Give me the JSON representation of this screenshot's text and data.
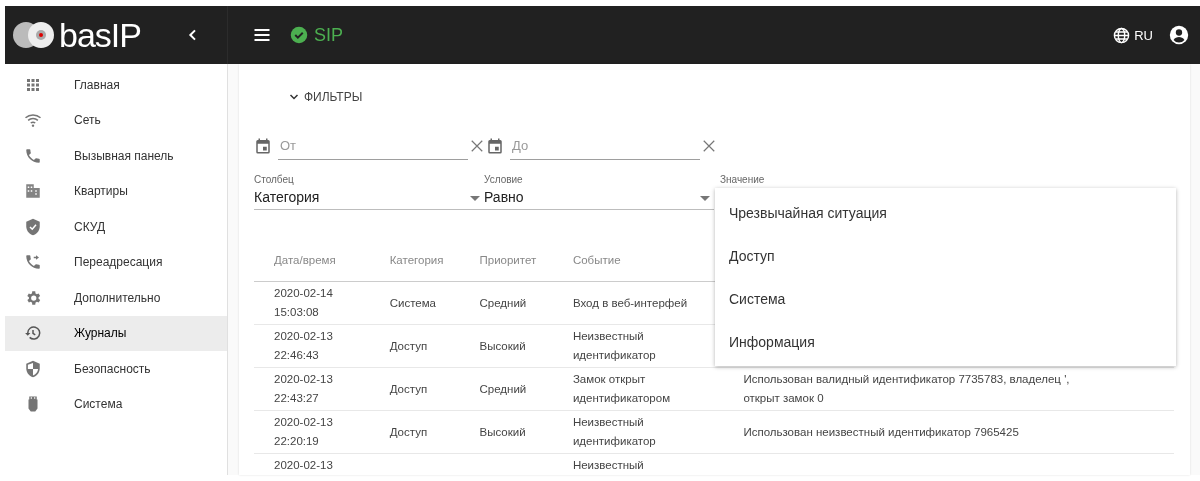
{
  "header": {
    "logo": "basIP",
    "status": {
      "label": "SIP",
      "ok": true
    },
    "language": "RU"
  },
  "sidebar": {
    "items": [
      {
        "label": "Главная",
        "selected": false
      },
      {
        "label": "Сеть",
        "selected": false
      },
      {
        "label": "Вызывная панель",
        "selected": false
      },
      {
        "label": "Квартиры",
        "selected": false
      },
      {
        "label": "СКУД",
        "selected": false
      },
      {
        "label": "Переадресация",
        "selected": false
      },
      {
        "label": "Дополнительно",
        "selected": false
      },
      {
        "label": "Журналы",
        "selected": true
      },
      {
        "label": "Безопасность",
        "selected": false
      },
      {
        "label": "Система",
        "selected": false
      }
    ]
  },
  "filters": {
    "toggle": "ФИЛЬТРЫ",
    "expanded": true,
    "date_from": {
      "placeholder": "От"
    },
    "date_to": {
      "placeholder": "До"
    },
    "selects": [
      {
        "label": "Столбец",
        "value": "Категория"
      },
      {
        "label": "Условие",
        "value": "Равно"
      },
      {
        "label": "Значение"
      }
    ],
    "value_menu": {
      "items": [
        "Чрезвычайная ситуация",
        "Доступ",
        "Система",
        "Информация"
      ]
    }
  },
  "table": {
    "columns": [
      "Дата/время",
      "Категория",
      "Приоритет",
      "Событие"
    ],
    "rows": [
      {
        "datetime": "2020-02-14 15:03:08",
        "category": "Система",
        "priority": "Средний",
        "event": "Вход в веб-интерфей"
      },
      {
        "datetime": "2020-02-13 22:46:43",
        "category": "Доступ",
        "priority": "Высокий",
        "event": "Неизвестный идентификатор"
      },
      {
        "datetime": "2020-02-13 22:43:27",
        "category": "Доступ",
        "priority": "Средний",
        "event": "Замок открыт идентификатором",
        "description": "Использован валидный идентификатор 7735783, владелец ', открыт замок 0"
      },
      {
        "datetime": "2020-02-13 22:20:19",
        "category": "Доступ",
        "priority": "Высокий",
        "event": "Неизвестный идентификатор",
        "description": "Использован неизвестный идентификатор 7965425"
      },
      {
        "datetime": "2020-02-13",
        "event": "Неизвестный"
      }
    ]
  }
}
